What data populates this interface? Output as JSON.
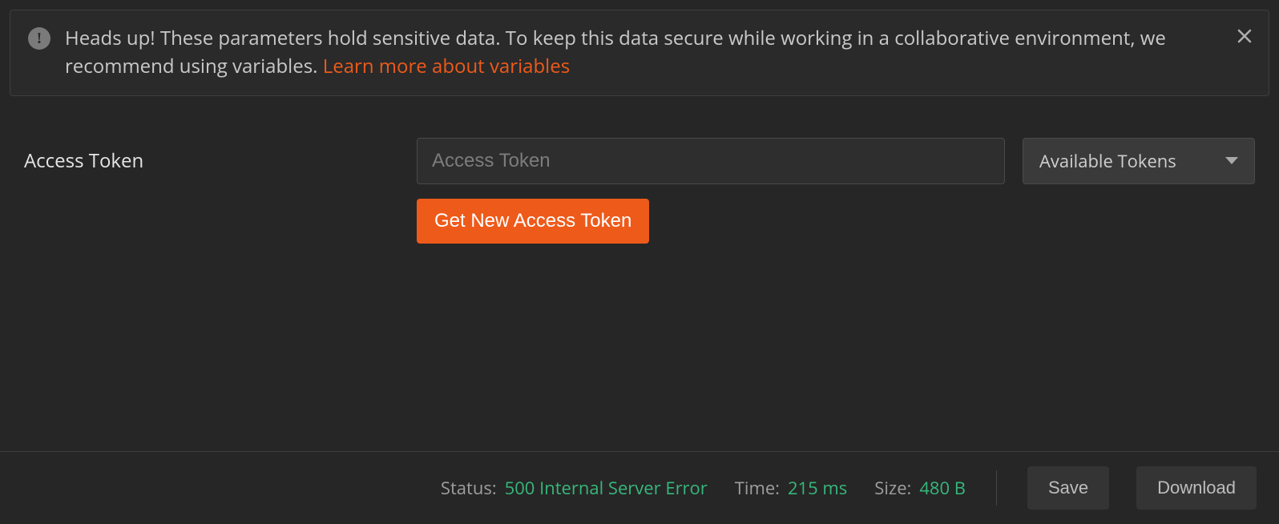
{
  "alert": {
    "lead": "Heads up!",
    "body_a": "These parameters hold sensitive data. To keep this data secure while working in a collaborative environment, we recommend using variables.",
    "link": "Learn more about variables"
  },
  "form": {
    "access_token": {
      "label": "Access Token",
      "placeholder": "Access Token",
      "value": "",
      "dropdown_label": "Available Tokens",
      "button": "Get New Access Token"
    }
  },
  "statusbar": {
    "status_label": "Status:",
    "status_value": "500 Internal Server Error",
    "time_label": "Time:",
    "time_value": "215 ms",
    "size_label": "Size:",
    "size_value": "480 B",
    "save": "Save",
    "download": "Download"
  }
}
